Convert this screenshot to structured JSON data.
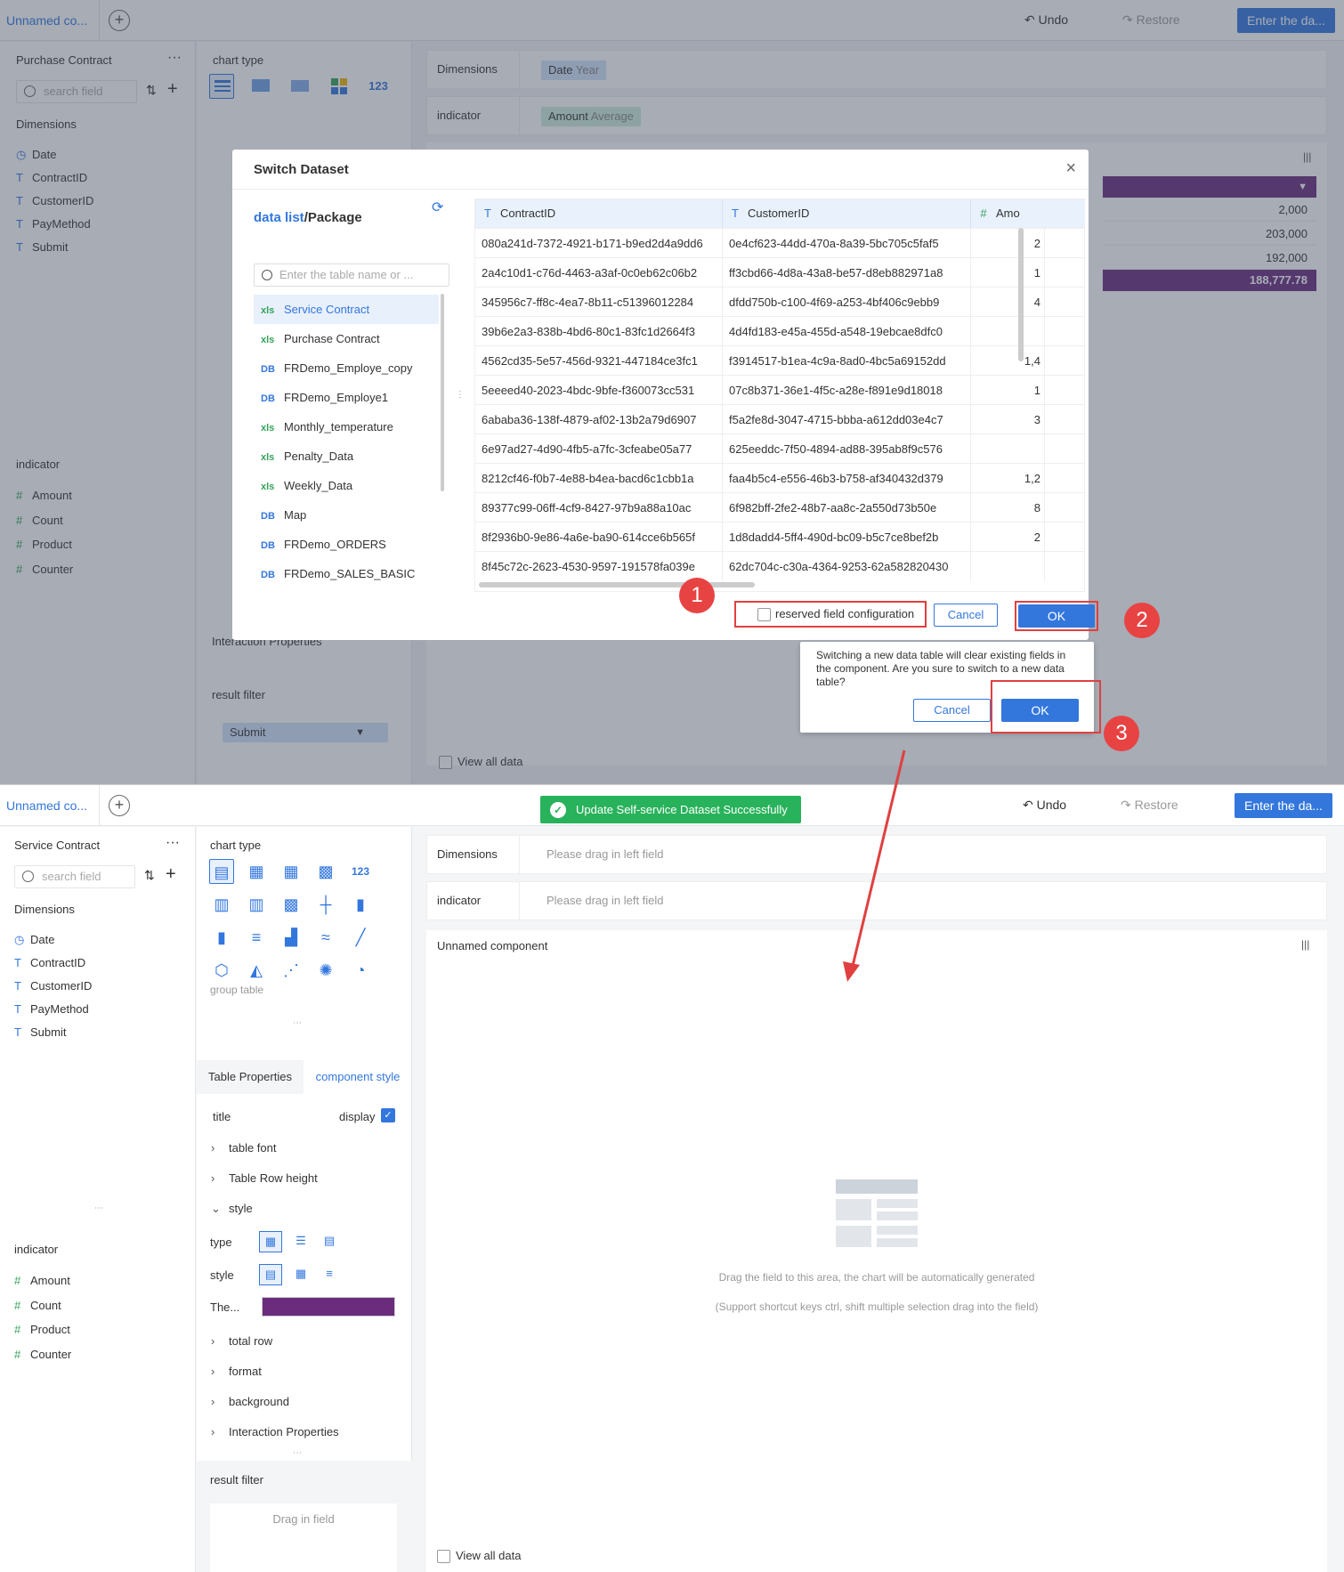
{
  "top": {
    "tab_label": "Unnamed co...",
    "undo": "Undo",
    "restore": "Restore",
    "enter": "Enter the da...",
    "dataset_name": "Purchase Contract",
    "search_placeholder": "search field",
    "dimensions_label": "Dimensions",
    "dimension_fields": [
      "Date",
      "ContractID",
      "CustomerID",
      "PayMethod",
      "Submit"
    ],
    "indicator_label": "indicator",
    "indicator_fields": [
      "Amount",
      "Count",
      "Product",
      "Counter"
    ],
    "chart_type_label": "chart type",
    "dim_bar_label": "Dimensions",
    "dim_pill": "Date",
    "dim_pill_sub": "Year",
    "ind_bar_label": "indicator",
    "ind_pill": "Amount",
    "ind_pill_sub": "Average",
    "table_values": [
      "2,000",
      "203,000",
      "192,000",
      "188,777.78"
    ],
    "interaction_props": "Interaction Properties",
    "result_filter": "result filter",
    "submit_pill": "Submit",
    "view_all": "View all data",
    "partial_labels": [
      "group",
      "Tabl",
      "title",
      "type",
      "style",
      "The"
    ]
  },
  "modal": {
    "title": "Switch Dataset",
    "data_list": "data list",
    "package": "/Package",
    "table_search_placeholder": "Enter the table name or ...",
    "tables": [
      {
        "name": "Service Contract",
        "kind": "xls"
      },
      {
        "name": "Purchase Contract",
        "kind": "xls"
      },
      {
        "name": "FRDemo_Employe_copy",
        "kind": "DB"
      },
      {
        "name": "FRDemo_Employe1",
        "kind": "DB"
      },
      {
        "name": "Monthly_temperature",
        "kind": "xls"
      },
      {
        "name": "Penalty_Data",
        "kind": "xls"
      },
      {
        "name": "Weekly_Data",
        "kind": "xls"
      },
      {
        "name": "Map",
        "kind": "DB"
      },
      {
        "name": "FRDemo_ORDERS",
        "kind": "DB"
      },
      {
        "name": "FRDemo_SALES_BASIC",
        "kind": "DB"
      }
    ],
    "columns": [
      "ContractID",
      "CustomerID",
      "Amo"
    ],
    "rows": [
      [
        "080a241d-7372-4921-b171-b9ed2d4a9dd6",
        "0e4cf623-44dd-470a-8a39-5bc705c5faf5",
        "2"
      ],
      [
        "2a4c10d1-c76d-4463-a3af-0c0eb62c06b2",
        "ff3cbd66-4d8a-43a8-be57-d8eb882971a8",
        "1"
      ],
      [
        "345956c7-ff8c-4ea7-8b11-c51396012284",
        "dfdd750b-c100-4f69-a253-4bf406c9ebb9",
        "4"
      ],
      [
        "39b6e2a3-838b-4bd6-80c1-83fc1d2664f3",
        "4d4fd183-e45a-455d-a548-19ebcae8dfc0",
        ""
      ],
      [
        "4562cd35-5e57-456d-9321-447184ce3fc1",
        "f3914517-b1ea-4c9a-8ad0-4bc5a69152dd",
        "1,4"
      ],
      [
        "5eeeed40-2023-4bdc-9bfe-f360073cc531",
        "07c8b371-36e1-4f5c-a28e-f891e9d18018",
        "1"
      ],
      [
        "6ababa36-138f-4879-af02-13b2a79d6907",
        "f5a2fe8d-3047-4715-bbba-a612dd03e4c7",
        "3"
      ],
      [
        "6e97ad27-4d90-4fb5-a7fc-3cfeabe05a77",
        "625eeddc-7f50-4894-ad88-395ab8f9c576",
        ""
      ],
      [
        "8212cf46-f0b7-4e88-b4ea-bacd6c1cbb1a",
        "faa4b5c4-e556-46b3-b758-af340432d379",
        "1,2"
      ],
      [
        "89377c99-06ff-4cf9-8427-97b9a88a10ac",
        "6f982bff-2fe2-48b7-aa8c-2a550d73b50e",
        "8"
      ],
      [
        "8f2936b0-9e86-4a6e-ba90-614cce6b565f",
        "1d8dadd4-5ff4-490d-bc09-b5c7ce8bef2b",
        "2"
      ],
      [
        "8f45c72c-2623-4530-9597-191578fa039e",
        "62dc704c-c30a-4364-9253-62a582820430",
        ""
      ]
    ],
    "reserved_label": "reserved field configuration",
    "cancel": "Cancel",
    "ok": "OK",
    "confirm_text": "Switching a new data table will clear existing fields in the component. Are you sure to switch to a new data table?",
    "confirm_cancel": "Cancel",
    "confirm_ok": "OK"
  },
  "badges": [
    "1",
    "2",
    "3"
  ],
  "bottom": {
    "tab_label": "Unnamed co...",
    "toast": "Update Self-service Dataset Successfully",
    "undo": "Undo",
    "restore": "Restore",
    "enter": "Enter the da...",
    "dataset_name": "Service Contract",
    "search_placeholder": "search field",
    "dimensions_label": "Dimensions",
    "dimension_fields": [
      "Date",
      "ContractID",
      "CustomerID",
      "PayMethod",
      "Submit"
    ],
    "indicator_label": "indicator",
    "indicator_fields": [
      "Amount",
      "Count",
      "Product",
      "Counter"
    ],
    "chart_type_label": "chart type",
    "group_table": "group table",
    "table_properties": "Table Properties",
    "component_style": "component style",
    "title": "title",
    "display": "display",
    "table_font": "table font",
    "row_height": "Table Row height",
    "style": "style",
    "type": "type",
    "style2": "style",
    "theme": "The...",
    "theme_color": "#6b2c7e",
    "total_row": "total row",
    "format": "format",
    "background": "background",
    "interaction": "Interaction Properties",
    "result_filter": "result filter",
    "drag_in_field": "Drag in field",
    "dim_bar_label": "Dimensions",
    "ind_bar_label": "indicator",
    "drag_hint": "Please drag in left field",
    "component_name": "Unnamed component",
    "empty_line1": "Drag the field to this area, the chart will be automatically generated",
    "empty_line2": "(Support shortcut keys ctrl, shift multiple selection drag into the field)",
    "view_all": "View all data"
  },
  "colors": {
    "accent": "#3377dd",
    "success": "#28b25b",
    "annotation": "#e04040",
    "purple": "#6b2c7e"
  }
}
